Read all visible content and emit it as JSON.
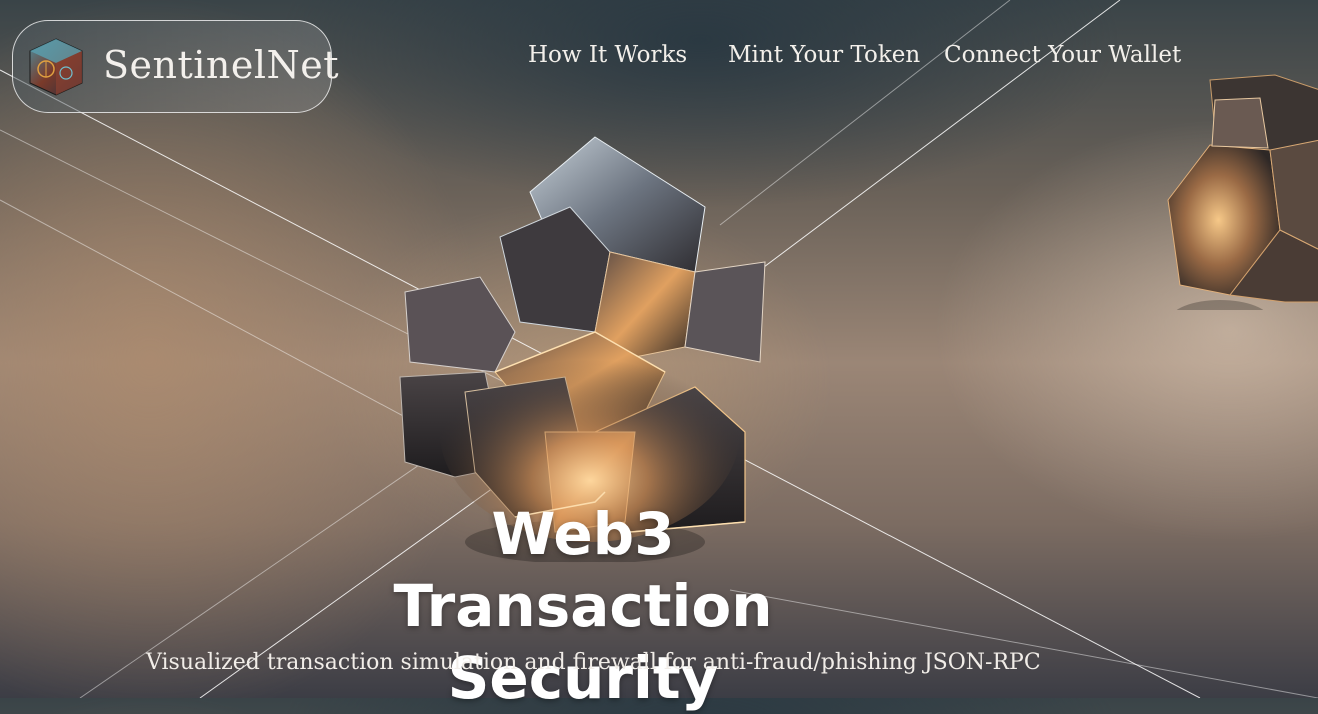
{
  "brand": {
    "name": "SentinelNet",
    "logo_icon": "crystal-cube-icon"
  },
  "nav": {
    "items": [
      {
        "label": "How It Works"
      },
      {
        "label": "Mint Your Token"
      },
      {
        "label": "Connect Your Wallet"
      }
    ]
  },
  "hero": {
    "title_line1": "Web3 Transaction",
    "title_line2": "Security",
    "subtitle": "Visualized transaction simulation and firewall for anti-fraud/phishing JSON-RPC"
  },
  "colors": {
    "text": "#ffffff",
    "crystal_glow": "#f0b070",
    "crystal_dark": "#2c2a2a"
  }
}
